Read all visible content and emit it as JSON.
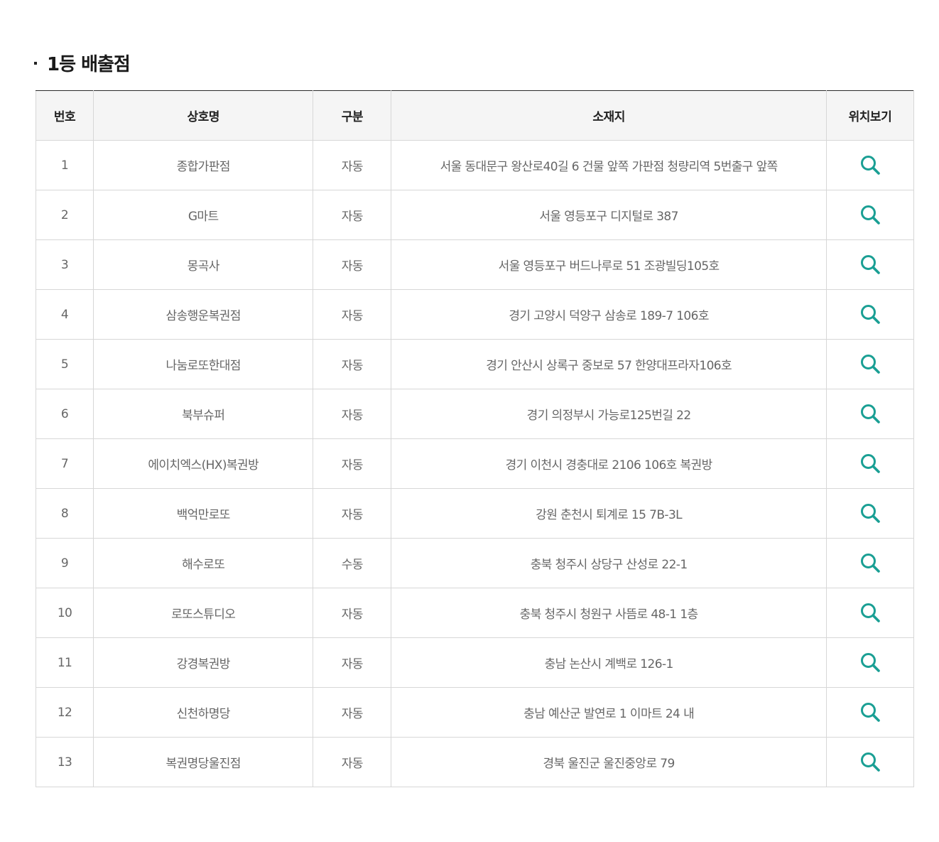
{
  "section": {
    "title": "1등 배출점"
  },
  "colors": {
    "accent": "#1a9f94",
    "header_bg": "#f5f5f5",
    "border": "#d7d7d7",
    "top_border": "#2b2b2b"
  },
  "table": {
    "headers": {
      "no": "번호",
      "name": "상호명",
      "type": "구분",
      "address": "소재지",
      "map": "위치보기"
    },
    "map_icon": "search-icon",
    "rows": [
      {
        "no": "1",
        "name": "종합가판점",
        "type": "자동",
        "address": "서울 동대문구 왕산로40길 6 건물 앞쪽 가판점 청량리역 5번출구 앞쪽"
      },
      {
        "no": "2",
        "name": "G마트",
        "type": "자동",
        "address": "서울 영등포구 디지털로 387"
      },
      {
        "no": "3",
        "name": "몽곡사",
        "type": "자동",
        "address": "서울 영등포구 버드나루로 51 조광빌딩105호"
      },
      {
        "no": "4",
        "name": "삼송행운복권점",
        "type": "자동",
        "address": "경기 고양시 덕양구 삼송로 189-7 106호"
      },
      {
        "no": "5",
        "name": "나눔로또한대점",
        "type": "자동",
        "address": "경기 안산시 상록구 중보로 57 한양대프라자106호"
      },
      {
        "no": "6",
        "name": "북부슈퍼",
        "type": "자동",
        "address": "경기 의정부시 가능로125번길 22"
      },
      {
        "no": "7",
        "name": "에이치엑스(HX)복권방",
        "type": "자동",
        "address": "경기 이천시 경충대로 2106 106호 복권방"
      },
      {
        "no": "8",
        "name": "백억만로또",
        "type": "자동",
        "address": "강원 춘천시 퇴계로 15 7B-3L"
      },
      {
        "no": "9",
        "name": "해수로또",
        "type": "수동",
        "address": "충북 청주시 상당구 산성로 22-1"
      },
      {
        "no": "10",
        "name": "로또스튜디오",
        "type": "자동",
        "address": "충북 청주시 청원구 사뜸로 48-1 1층"
      },
      {
        "no": "11",
        "name": "강경복권방",
        "type": "자동",
        "address": "충남 논산시 계백로 126-1"
      },
      {
        "no": "12",
        "name": "신천하명당",
        "type": "자동",
        "address": "충남 예산군 발연로 1 이마트 24 내"
      },
      {
        "no": "13",
        "name": "복권명당울진점",
        "type": "자동",
        "address": "경북 울진군 울진중앙로 79"
      }
    ]
  }
}
